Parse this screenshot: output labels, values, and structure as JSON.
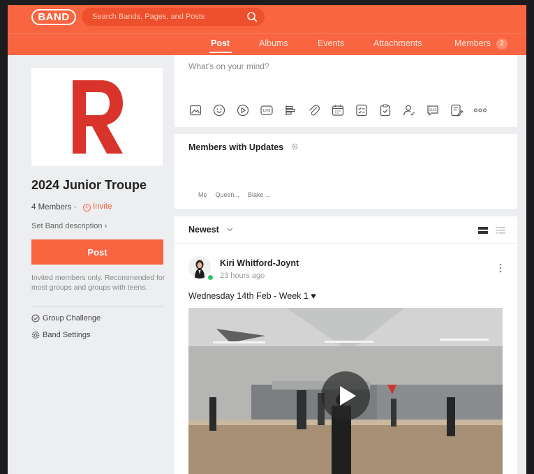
{
  "header": {
    "logo_text": "BAND",
    "search_placeholder": "Search Bands, Pages, and Posts",
    "tabs": [
      {
        "label": "Post",
        "active": true
      },
      {
        "label": "Albums"
      },
      {
        "label": "Events"
      },
      {
        "label": "Attachments"
      },
      {
        "label": "Members",
        "badge": "2"
      }
    ]
  },
  "sidebar": {
    "band_title": "2024 Junior Troupe",
    "members_count": "4 Members ·",
    "invite_label": "Invite",
    "band_description": "Set Band description ›",
    "post_button": "Post",
    "privacy_text": "Invited members only. Recommended for most groups and groups with teens.",
    "links": [
      {
        "label": "Group Challenge",
        "icon": "check-circle-icon"
      },
      {
        "label": "Band Settings",
        "icon": "gear-icon"
      }
    ]
  },
  "composer": {
    "placeholder": "What's on your mind?",
    "tools": [
      "photo-icon",
      "emoji-icon",
      "video-icon",
      "live-icon",
      "poll-icon",
      "attachment-icon",
      "calendar-icon",
      "checklist-icon",
      "todo-icon",
      "mention-icon",
      "quiz-icon",
      "survey-icon",
      "more-icon"
    ]
  },
  "updates": {
    "title": "Members with Updates",
    "names": [
      "Me",
      "Queen...",
      "Blake ..."
    ]
  },
  "feed": {
    "sort_label": "Newest",
    "post": {
      "author": "Kiri Whitford-Joynt",
      "time": "23 hours ago",
      "text": "Wednesday 14th Feb - Week 1 ♥"
    }
  },
  "colors": {
    "brand": "#f86540",
    "logo_red": "#d9342b"
  }
}
